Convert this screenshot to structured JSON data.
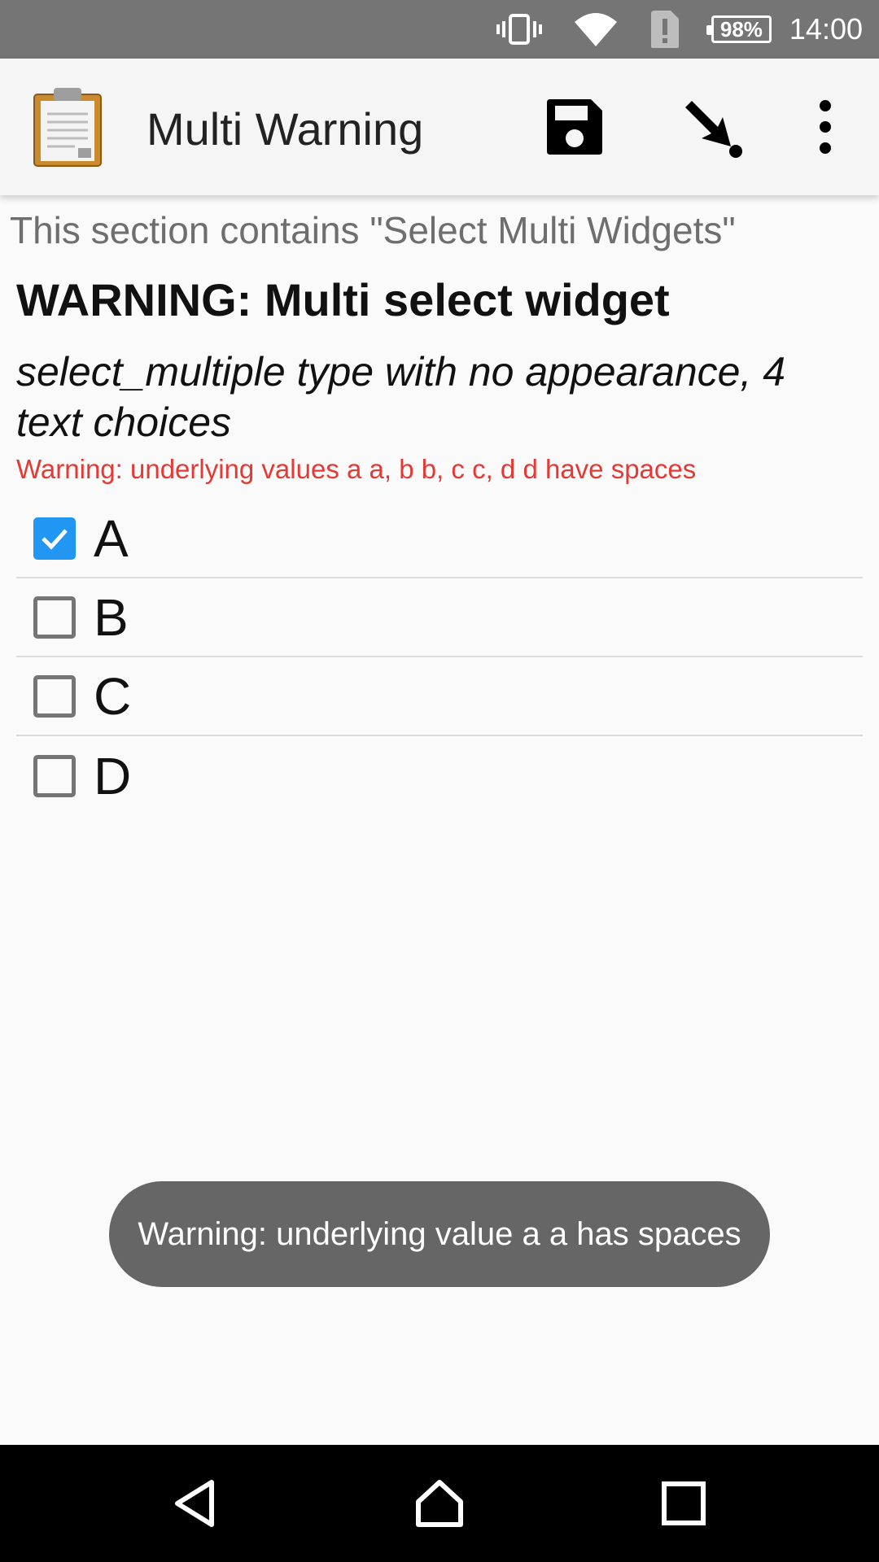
{
  "status_bar": {
    "battery": "98%",
    "time": "14:00",
    "icons": [
      "vibrate-icon",
      "wifi-icon",
      "sim-alert-icon",
      "battery-icon"
    ]
  },
  "app_bar": {
    "title": "Multi Warning",
    "icons": [
      "clipboard-logo-icon",
      "save-icon",
      "goto-icon",
      "overflow-menu-icon"
    ]
  },
  "form": {
    "section_hint": "This section contains \"Select Multi Widgets\"",
    "question_title": "WARNING: Multi select widget",
    "question_hint": "select_multiple type with no appearance, 4 text choices",
    "warning": "Warning: underlying values a a, b b, c c, d d have spaces",
    "choices": [
      {
        "label": "A",
        "checked": true
      },
      {
        "label": "B",
        "checked": false
      },
      {
        "label": "C",
        "checked": false
      },
      {
        "label": "D",
        "checked": false
      }
    ]
  },
  "toast": {
    "text": "Warning: underlying value a a has spaces"
  },
  "nav_bar": {
    "icons": [
      "back-icon",
      "home-icon",
      "recents-icon"
    ]
  },
  "colors": {
    "status_bar": "#757575",
    "app_bar": "#f5f5f5",
    "checkbox_checked": "#2196f3",
    "warning": "#e53935",
    "toast": "#666666"
  }
}
